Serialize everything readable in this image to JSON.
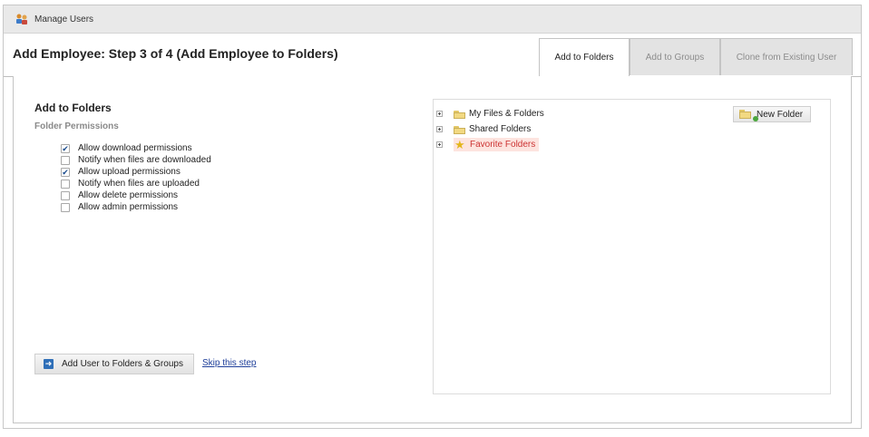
{
  "topbar": {
    "title": "Manage Users",
    "icon": "users-icon"
  },
  "page": {
    "title": "Add Employee: Step 3 of 4 (Add Employee to Folders)"
  },
  "tabs": [
    {
      "label": "Add to Folders",
      "active": true
    },
    {
      "label": "Add to Groups",
      "active": false
    },
    {
      "label": "Clone from Existing User",
      "active": false
    }
  ],
  "folders_section": {
    "title": "Add to Folders",
    "subtitle": "Folder Permissions",
    "permissions": [
      {
        "label": "Allow download permissions",
        "checked": true
      },
      {
        "label": "Notify when files are downloaded",
        "checked": false
      },
      {
        "label": "Allow upload permissions",
        "checked": true
      },
      {
        "label": "Notify when files are uploaded",
        "checked": false
      },
      {
        "label": "Allow delete permissions",
        "checked": false
      },
      {
        "label": "Allow admin permissions",
        "checked": false
      }
    ]
  },
  "actions": {
    "add_button": "Add User to Folders & Groups",
    "skip_link": "Skip this step"
  },
  "tree": {
    "new_folder_button": "New Folder",
    "items": [
      {
        "label": "My Files & Folders",
        "icon": "folder-icon"
      },
      {
        "label": "Shared Folders",
        "icon": "folder-icon"
      },
      {
        "label": "Favorite Folders",
        "icon": "star-icon",
        "highlighted": true
      }
    ]
  },
  "colors": {
    "favorite_text": "#cc3333",
    "favorite_bg": "#fde4df",
    "link": "#1f3f9a",
    "button_arrow": "#2f6fb8"
  }
}
